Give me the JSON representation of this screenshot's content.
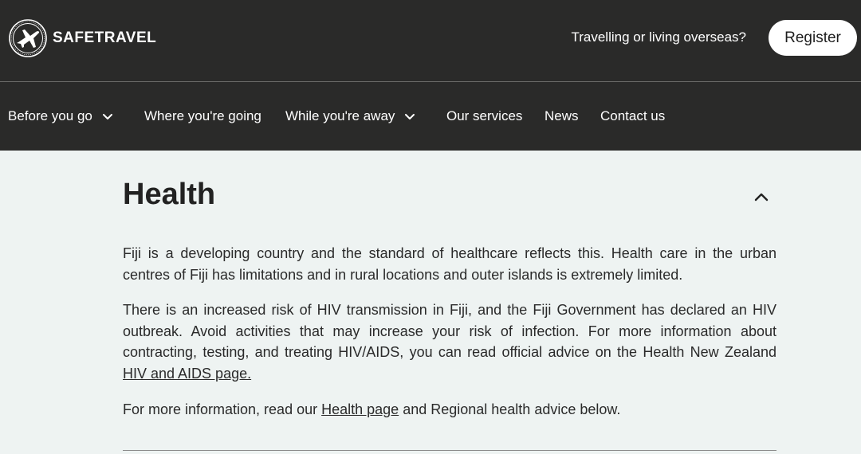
{
  "header": {
    "logo_text": "SAFETRAVEL",
    "question": "Travelling or living overseas?",
    "register_label": "Register"
  },
  "nav": {
    "items": [
      {
        "label": "Before you go",
        "has_dropdown": true
      },
      {
        "label": "Where you're going",
        "has_dropdown": false
      },
      {
        "label": "While you're away",
        "has_dropdown": true
      },
      {
        "label": "Our services",
        "has_dropdown": false
      },
      {
        "label": "News",
        "has_dropdown": false
      },
      {
        "label": "Contact us",
        "has_dropdown": false
      }
    ]
  },
  "section": {
    "title": "Health",
    "expanded": true,
    "p1": "Fiji is a developing country and the standard of healthcare reflects this. Health care in the urban centres of Fiji has limitations and in rural locations and outer islands is extremely limited.",
    "p2_text": "There is an increased risk of HIV transmission in Fiji, and the Fiji Government has declared an HIV outbreak. Avoid activities that may increase your risk of infection. For more information about contracting, testing, and treating HIV/AIDS, you can read official advice on the Health New Zealand ",
    "p2_link": "HIV and AIDS page.",
    "p3_before": "For more information, read our ",
    "p3_link": "Health page",
    "p3_after": " and Regional health advice below."
  },
  "colors": {
    "header_bg": "#2a2a29",
    "page_bg": "#eef3f2",
    "text": "#222222"
  }
}
